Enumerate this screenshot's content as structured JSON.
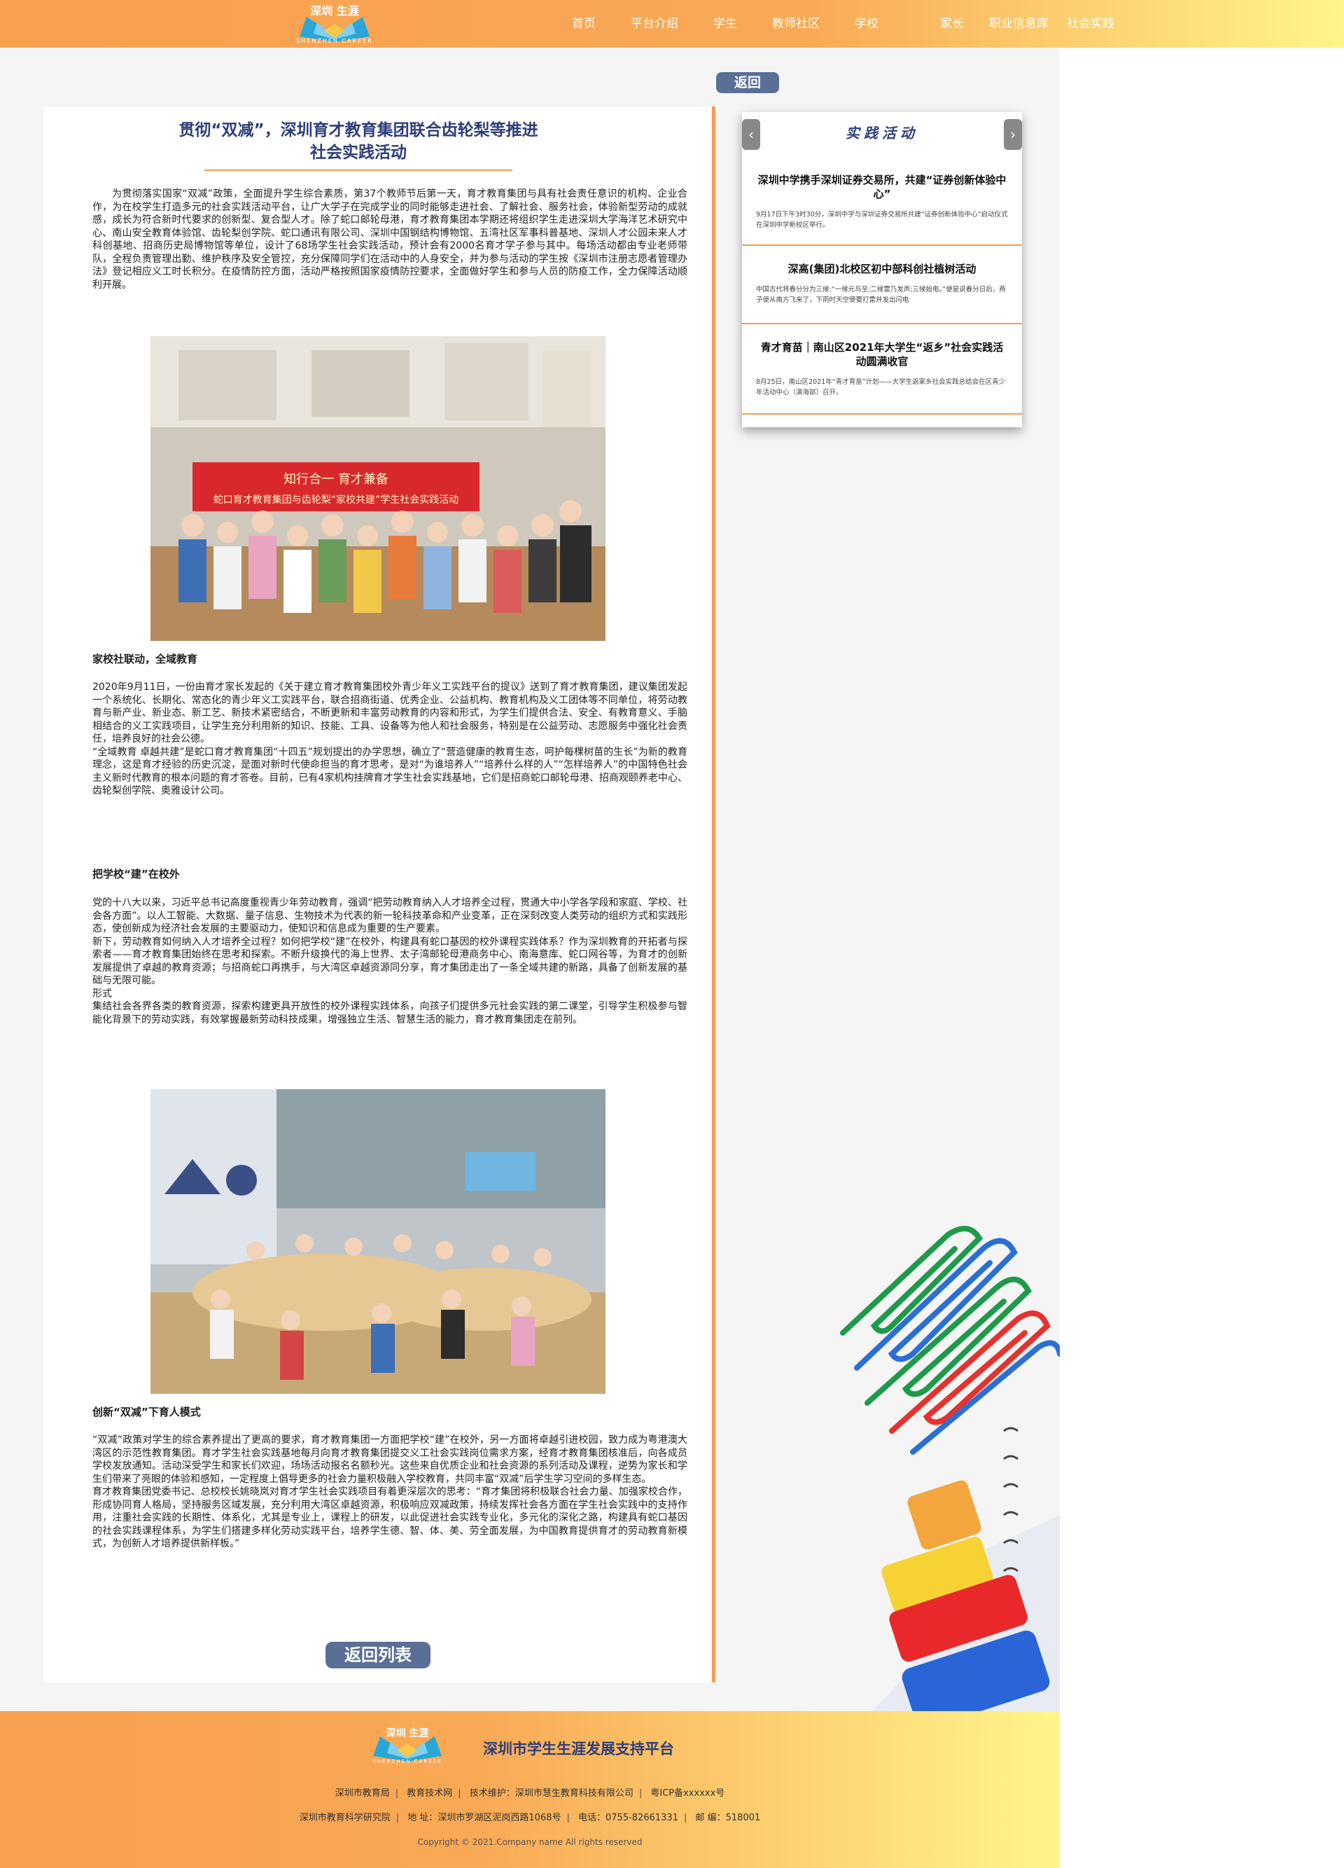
{
  "header": {
    "logo_text": "深圳\n生涯",
    "logo_sub": "SHENZHEN CAREER",
    "nav": [
      "首页",
      "平台介绍",
      "学生",
      "教师社区",
      "学校",
      "家长",
      "职业信息库",
      "社会实践"
    ]
  },
  "back_label": "返回",
  "article": {
    "title": "贯彻“双减”，深圳育才教育集团联合齿轮梨等推进社会实践活动",
    "intro": "为贯彻落实国家“双减”政策，全面提升学生综合素质，第37个教师节后第一天，育才教育集团与具有社会责任意识的机构、企业合作，为在校学生打造多元的社会实践活动平台，让广大学子在完成学业的同时能够走进社会、了解社会、服务社会，体验新型劳动的成就感，成长为符合新时代要求的创新型、复合型人才。除了蛇口邮轮母港，育才教育集团本学期还将组织学生走进深圳大学海洋艺术研究中心、南山安全教育体验馆、齿轮梨创学院、蛇口通讯有限公司、深圳中国钢结构博物馆、五湾社区军事科普基地、深圳人才公园未来人才科创基地、招商历史局博物馆等单位，设计了68场学生社会实践活动，预计会有2000名育才学子参与其中。每场活动都由专业老师带队，全程负责管理出勤、维护秩序及安全管控，充分保障同学们在活动中的人身安全，并为参与活动的学生按《深圳市注册志愿者管理办法》登记相应义工时长积分。在疫情防控方面，活动严格按照国家疫情防控要求，全面做好学生和参与人员的防疫工作，全力保障活动顺利开展。",
    "photo1_banner1": "知行合一 育才兼备",
    "photo1_banner2": "蛇口育才教育集团与齿轮梨“家校共建”学生社会实践活动",
    "section1_title": "家校社联动，全域教育",
    "section1_p1": "2020年9月11日，一份由育才家长发起的《关于建立育才教育集团校外青少年义工实践平台的提议》送到了育才教育集团，建议集团发起一个系统化、长期化、常态化的青少年义工实践平台，联合招商街道、优秀企业、公益机构、教育机构及义工团体等不同单位，将劳动教育与新产业、新业态、新工艺、新技术紧密结合，不断更新和丰富劳动教育的内容和形式，为学生们提供合法、安全、有教育意义、手脑相结合的义工实践项目，让学生充分利用新的知识、技能、工具、设备等为他人和社会服务，特别是在公益劳动、志愿服务中强化社会责任，培养良好的社会公德。",
    "section1_p2": "“全域教育 卓越共建”是蛇口育才教育集团“十四五”规划提出的办学思想，确立了“营造健康的教育生态，呵护每棵树苗的生长”为新的教育理念，这是育才经验的历史沉淀，是面对新时代使命担当的育才思考，是对“为谁培养人”“培养什么样的人”“怎样培养人”的中国特色社会主义新时代教育的根本问题的育才答卷。目前，已有4家机构挂牌育才学生社会实践基地，它们是招商蛇口邮轮母港、招商观颐养老中心、齿轮梨创学院、奥雅设计公司。",
    "section2_title": "把学校“建”在校外",
    "section2_p1": "党的十八大以来，习近平总书记高度重视青少年劳动教育，强调“把劳动教育纳入人才培养全过程，贯通大中小学各学段和家庭、学校、社会各方面”。以人工智能、大数据、量子信息、生物技术为代表的新一轮科技革命和产业变革，正在深刻改变人类劳动的组织方式和实践形态，使创新成为经济社会发展的主要驱动力，使知识和信息成为重要的生产要素。",
    "section2_p2": "新下，劳动教育如何纳入人才培养全过程？如何把学校“建”在校外，构建具有蛇口基因的校外课程实践体系？作为深圳教育的开拓者与探索者——育才教育集团始终在思考和探索。不断升级换代的海上世界、太子湾邮轮母港商务中心、南海意库、蛇口网谷等，为育才的创新发展提供了卓越的教育资源；与招商蛇口再携手，与大湾区卓越资源同分享，育才集团走出了一条全域共建的新路，具备了创新发展的基础与无限可能。",
    "section2_p3": "形式",
    "section2_p4": "集结社会各界各类的教育资源，探索构建更具开放性的校外课程实践体系，向孩子们提供多元社会实践的第二课堂，引导学生积极参与智能化背景下的劳动实践，有效掌握最新劳动科技成果，增强独立生活、智慧生活的能力，育才教育集团走在前列。",
    "section3_title": "创新“双减”下育人模式",
    "section3_p1": "“双减”政策对学生的综合素养提出了更高的要求，育才教育集团一方面把学校“建”在校外，另一方面将卓越引进校园，致力成为粤港澳大湾区的示范性教育集团。育才学生社会实践基地每月向育才教育集团提交义工社会实践岗位需求方案，经育才教育集团核准后，向各成员学校发放通知。活动深受学生和家长们欢迎，场场活动报名名额秒光。这些来自优质企业和社会资源的系列活动及课程，逆势为家长和学生们带来了亮眼的体验和感知，一定程度上倡导更多的社会力量积极融入学校教育，共同丰富“双减”后学生学习空间的多样生态。",
    "section3_p2": "育才教育集团党委书记、总校校长姚晓岚对育才学生社会实践项目有着更深层次的思考：“育才集团将积极联合社会力量、加强家校合作，形成协同育人格局，坚持服务区域发展，充分利用大湾区卓越资源，积极响应双减政策，持续发挥社会各方面在学生社会实践中的支持作用，注重社会实践的长期性、体系化，尤其是专业上，课程上的研发，以此促进社会实践专业化，多元化的深化之路，构建具有蛇口基因的社会实践课程体系，为学生们搭建多样化劳动实践平台，培养学生德、智、体、美、劳全面发展，为中国教育提供育才的劳动教育新模式，为创新人才培养提供新样板。”",
    "return_list": "返回列表"
  },
  "sidebar": {
    "title": "实践活动",
    "items": [
      {
        "title": "深圳中学携手深圳证券交易所，共建“证券创新体验中心”",
        "desc": "9月17日下午3时30分，深圳中学与深圳证券交易所共建“证券创新体验中心”启动仪式在深圳中学新校区举行。"
      },
      {
        "title": "深高(集团)北校区初中部科创社植树活动",
        "desc": "中国古代将春分分为三候:“一候元鸟至;二候雷乃发声;三候始电。”便是说春分日后，燕子便从南方飞来了，下雨时天空便要打雷并发出闪电"
      },
      {
        "title": "青才育苗｜南山区2021年大学生“返乡”社会实践活动圆满收官",
        "desc": "8月25日，南山区2021年“青才育苗”计划——大学生返家乡社会实践总结会在区青少年活动中心（演海部）召开。"
      }
    ]
  },
  "footer": {
    "site_name": "深圳市学生生涯发展支持平台",
    "line1": [
      "深圳市教育局",
      "教育技术网",
      "技术维护：深圳市慧生教育科技有限公司",
      "粤ICP备xxxxxx号"
    ],
    "line2": [
      "深圳市教育科学研究院",
      "地 址：深圳市罗湖区泥岗西路1068号",
      "电话：0755-82661331",
      "邮 编：518001"
    ],
    "copyright": "Copyright © 2021.Company name All rights reserved"
  },
  "colors": {
    "accent": "#f39c52",
    "navy": "#2c3e7a",
    "button": "#5a6f96"
  }
}
